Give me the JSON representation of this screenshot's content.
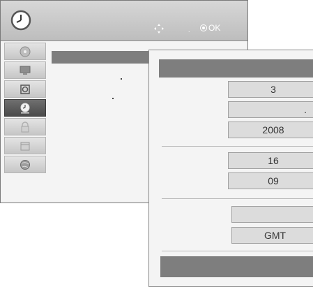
{
  "header": {
    "clock_icon": "clock-icon",
    "nav_icon": "four-way-arrow-icon",
    "hint_separator": ".",
    "ok_label": "OK",
    "accent_color": "#c8c8c8"
  },
  "sidebar": {
    "items": [
      {
        "icon": "disc-icon"
      },
      {
        "icon": "monitor-icon"
      },
      {
        "icon": "speaker-icon"
      },
      {
        "icon": "clock-icon",
        "active": true
      },
      {
        "icon": "lock-icon"
      },
      {
        "icon": "calendar-icon"
      },
      {
        "icon": "globe-icon"
      }
    ]
  },
  "date_time": {
    "day": "3",
    "month": ".",
    "year": "2008",
    "hour": "16",
    "minute": "09",
    "timezone_mode": "",
    "timezone": "GMT"
  }
}
